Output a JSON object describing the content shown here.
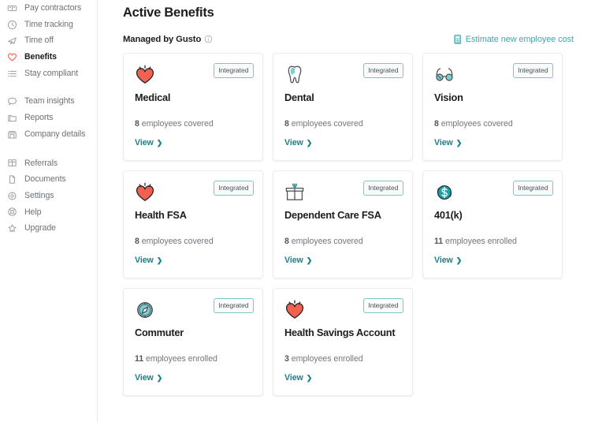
{
  "colors": {
    "accent_teal": "#17818c",
    "badge_border": "#7cc5c9",
    "heart_red": "#f45d48",
    "link_teal": "#4aa2a8",
    "text_dark": "#1c1d1f",
    "text_muted": "#73777d",
    "sidebar_border": "#e7e8ea"
  },
  "sidebar": {
    "groups": [
      {
        "items": [
          {
            "label": "Pay contractors",
            "icon": "contractors-icon",
            "active": false
          },
          {
            "label": "Time tracking",
            "icon": "clock-icon",
            "active": false
          },
          {
            "label": "Time off",
            "icon": "plane-icon",
            "active": false
          },
          {
            "label": "Benefits",
            "icon": "heart-icon",
            "active": true
          },
          {
            "label": "Stay compliant",
            "icon": "list-icon",
            "active": false
          }
        ]
      },
      {
        "items": [
          {
            "label": "Team insights",
            "icon": "chat-bubble-icon",
            "active": false
          },
          {
            "label": "Reports",
            "icon": "folder-icon",
            "active": false
          },
          {
            "label": "Company details",
            "icon": "building-icon",
            "active": false
          }
        ]
      },
      {
        "items": [
          {
            "label": "Referrals",
            "icon": "gift-grid-icon",
            "active": false
          },
          {
            "label": "Documents",
            "icon": "document-icon",
            "active": false
          },
          {
            "label": "Settings",
            "icon": "gear-icon",
            "active": false
          },
          {
            "label": "Help",
            "icon": "help-icon",
            "active": false
          },
          {
            "label": "Upgrade",
            "icon": "star-icon",
            "active": false
          }
        ]
      }
    ]
  },
  "header": {
    "title": "Active Benefits",
    "managed_by": "Managed by Gusto",
    "info_icon": "info-icon",
    "estimate_link": "Estimate new employee cost",
    "estimate_icon": "calculator-icon"
  },
  "benefits": [
    {
      "name": "Medical",
      "icon": "heart-icon",
      "badge": "Integrated",
      "count": "8",
      "count_suffix": " employees covered",
      "view_label": "View"
    },
    {
      "name": "Dental",
      "icon": "tooth-icon",
      "badge": "Integrated",
      "count": "8",
      "count_suffix": " employees covered",
      "view_label": "View"
    },
    {
      "name": "Vision",
      "icon": "glasses-icon",
      "badge": "Integrated",
      "count": "8",
      "count_suffix": " employees covered",
      "view_label": "View"
    },
    {
      "name": "Health FSA",
      "icon": "heart-icon",
      "badge": "Integrated",
      "count": "8",
      "count_suffix": " employees covered",
      "view_label": "View"
    },
    {
      "name": "Dependent Care FSA",
      "icon": "gift-icon",
      "badge": "Integrated",
      "count": "8",
      "count_suffix": " employees covered",
      "view_label": "View"
    },
    {
      "name": "401(k)",
      "icon": "dollar-circle-icon",
      "badge": "Integrated",
      "count": "11",
      "count_suffix": " employees enrolled",
      "view_label": "View"
    },
    {
      "name": "Commuter",
      "icon": "compass-icon",
      "badge": "Integrated",
      "count": "11",
      "count_suffix": " employees enrolled",
      "view_label": "View"
    },
    {
      "name": "Health Savings Account",
      "icon": "heart-icon",
      "badge": "Integrated",
      "count": "3",
      "count_suffix": " employees enrolled",
      "view_label": "View"
    }
  ]
}
